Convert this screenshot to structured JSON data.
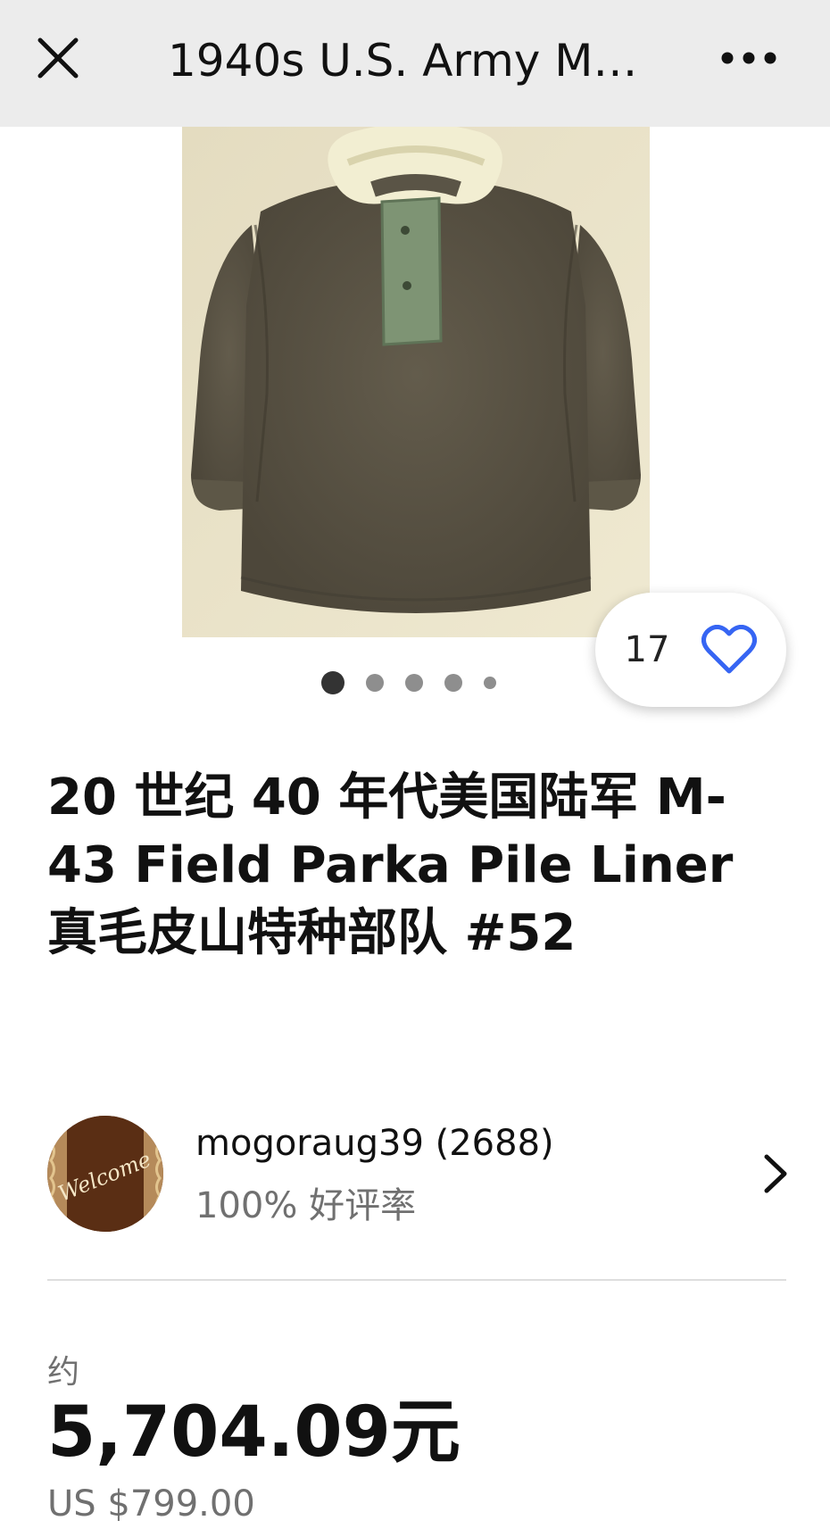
{
  "header": {
    "title": "1940s U.S. Army M…"
  },
  "gallery": {
    "watch_count": "17",
    "image_count": 5,
    "active_image_index": 1
  },
  "listing": {
    "title": "20 世纪 40 年代美国陆军 M-43 Field Parka Pile Liner 真毛皮山特种部队 #52"
  },
  "seller": {
    "name_and_score": "mogoraug39 (2688)",
    "feedback": "100% 好评率",
    "avatar_text": "Welcome"
  },
  "price": {
    "approx_label": "约",
    "local_price": "5,704.09元",
    "usd_price": "US $799.00"
  },
  "colors": {
    "header_bg": "#ececec",
    "heart_blue": "#3665f3",
    "parka": "#5a5446",
    "photo_wall": "#e9e2c6"
  }
}
